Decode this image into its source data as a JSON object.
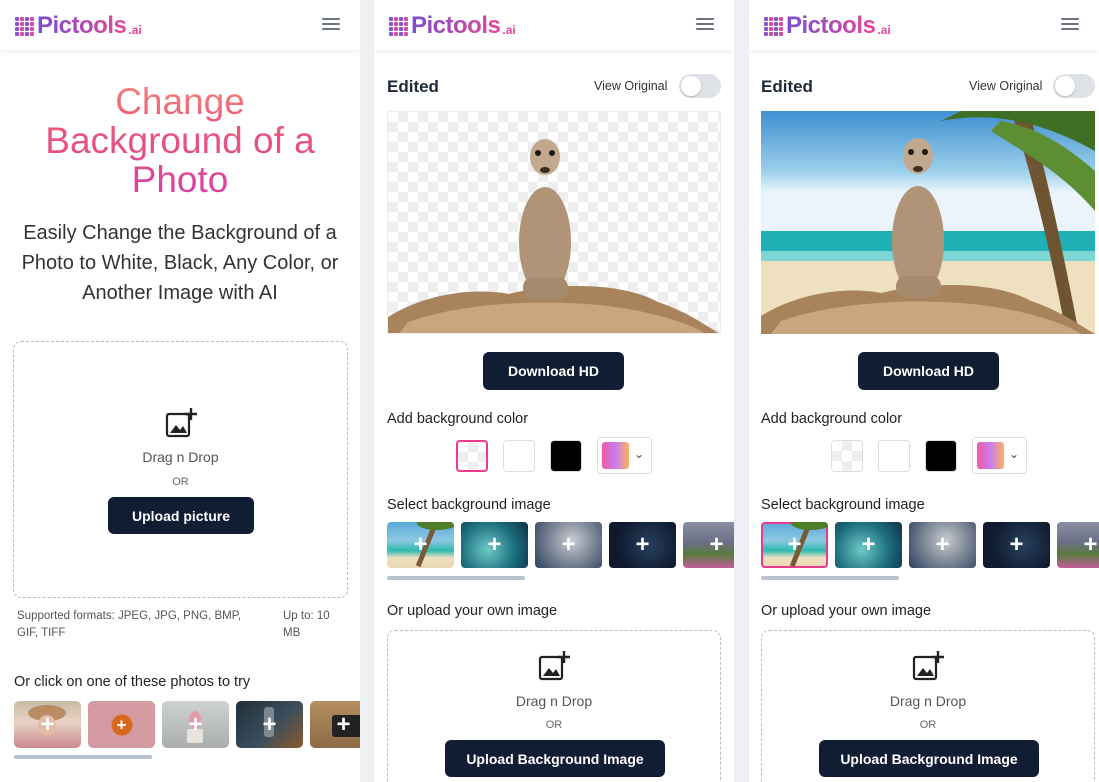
{
  "brand": {
    "name": "Pictools",
    "suffix": ".ai"
  },
  "colors": {
    "accent_pink": "#e93a8e",
    "dark_button": "#111d33",
    "hero_gradient": [
      "#f3857a",
      "#ec5679",
      "#d63fa8"
    ]
  },
  "landing": {
    "title": "Change Background of a Photo",
    "subtitle": "Easily Change the Background of a Photo to White, Black, Any Color, or Another Image with AI",
    "dropzone": {
      "icon": "add-photo-icon",
      "text": "Drag n Drop",
      "or": "OR",
      "button": "Upload picture"
    },
    "formats": "Supported formats: JPEG, JPG, PNG, BMP, GIF, TIFF",
    "limit": "Up to: 10 MB",
    "try_label": "Or click on one of these photos to try",
    "samples": [
      {
        "name": "woman-in-hat"
      },
      {
        "name": "orange-fruit"
      },
      {
        "name": "potted-plant"
      },
      {
        "name": "glass-bottle"
      },
      {
        "name": "camera"
      }
    ]
  },
  "editor_transparent": {
    "edited_label": "Edited",
    "view_original_label": "View Original",
    "view_original_on": false,
    "download_label": "Download HD",
    "bg_color_label": "Add background color",
    "color_options": [
      {
        "name": "transparent",
        "selected": true
      },
      {
        "name": "white",
        "color": "#ffffff"
      },
      {
        "name": "black",
        "color": "#000000"
      },
      {
        "name": "gradient-picker"
      }
    ],
    "bg_image_label": "Select background image",
    "bg_images": [
      "beach-palm",
      "teal-ocean",
      "cloudy-sky",
      "night-sky",
      "mountain-flowers"
    ],
    "selected_bg_image": null,
    "upload_label": "Or upload your own image",
    "upload": {
      "text": "Drag n Drop",
      "or": "OR",
      "button": "Upload Background Image"
    }
  },
  "editor_beach": {
    "edited_label": "Edited",
    "view_original_label": "View Original",
    "view_original_on": false,
    "download_label": "Download HD",
    "bg_color_label": "Add background color",
    "color_options": [
      {
        "name": "transparent",
        "selected": false
      },
      {
        "name": "white",
        "color": "#ffffff"
      },
      {
        "name": "black",
        "color": "#000000"
      },
      {
        "name": "gradient-picker"
      }
    ],
    "bg_image_label": "Select background image",
    "bg_images": [
      "beach-palm",
      "teal-ocean",
      "cloudy-sky",
      "night-sky",
      "mountain-flowers"
    ],
    "selected_bg_image": "beach-palm",
    "upload_label": "Or upload your own image",
    "upload": {
      "text": "Drag n Drop",
      "or": "OR",
      "button": "Upload Background Image"
    }
  }
}
